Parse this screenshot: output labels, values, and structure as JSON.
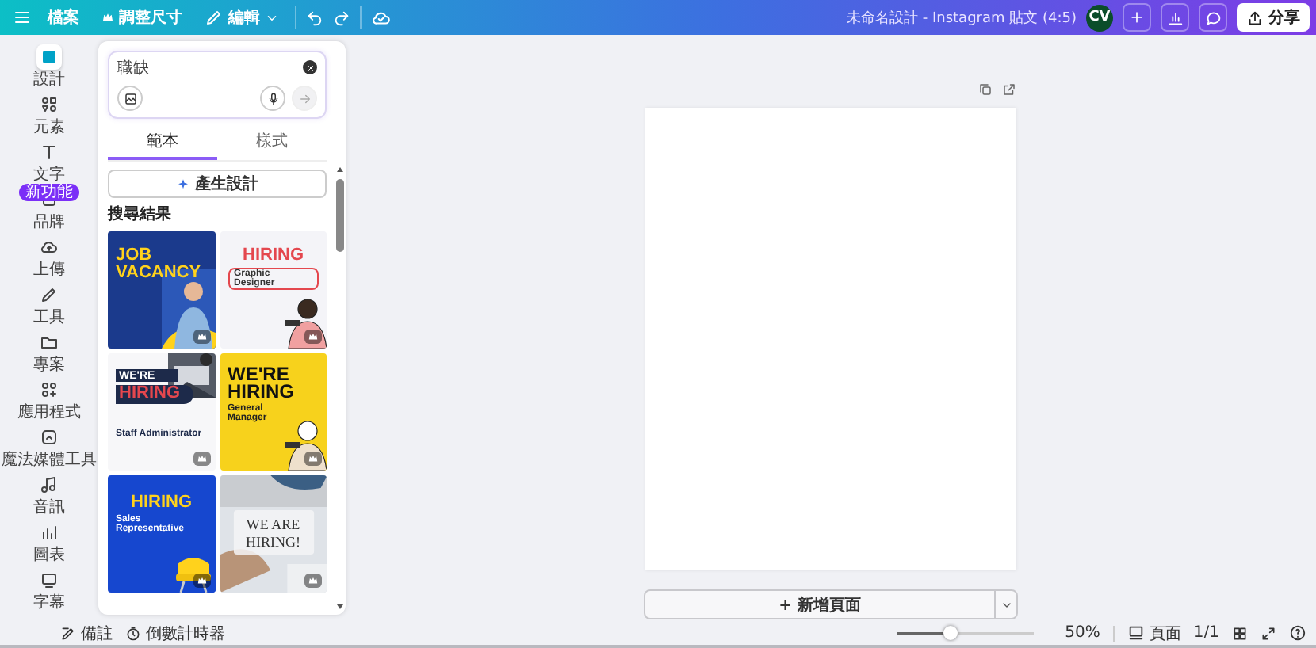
{
  "topbar": {
    "menu_items": [
      {
        "label": "檔案",
        "kind": "plain"
      },
      {
        "label": "調整尺寸",
        "kind": "crown"
      },
      {
        "label": "編輯",
        "kind": "edit"
      }
    ],
    "title": "未命名設計 - Instagram 貼文 (4:5)",
    "avatar": "CV",
    "share": "分享"
  },
  "rail": {
    "items": [
      {
        "label": "設計",
        "selected": true
      },
      {
        "label": "元素",
        "selected": false
      },
      {
        "label": "文字",
        "selected": false
      },
      {
        "label": "品牌",
        "selected": false,
        "badge": "新功能"
      },
      {
        "label": "上傳",
        "selected": false
      },
      {
        "label": "工具",
        "selected": false
      },
      {
        "label": "專案",
        "selected": false
      },
      {
        "label": "應用程式",
        "selected": false
      },
      {
        "label": "魔法媒體工具",
        "selected": false
      },
      {
        "label": "音訊",
        "selected": false
      },
      {
        "label": "圖表",
        "selected": false
      },
      {
        "label": "字幕",
        "selected": false
      }
    ]
  },
  "panel": {
    "search": {
      "value": "職缺"
    },
    "tabs": [
      {
        "label": "範本",
        "selected": true
      },
      {
        "label": "樣式",
        "selected": false
      }
    ],
    "generate_button": "產生設計",
    "results_heading": "搜尋結果",
    "templates": [
      {
        "kind": "navy",
        "headline": "JOB VACANCY"
      },
      {
        "kind": "light",
        "headline": "HIRING",
        "subtitle": "Graphic Designer"
      },
      {
        "kind": "split",
        "kicker": "WE'RE",
        "headline": "HIRING",
        "subtitle": "Staff Administrator"
      },
      {
        "kind": "yellow",
        "headline": "WE'RE HIRING",
        "subtitle": "General Manager"
      },
      {
        "kind": "royal",
        "headline": "HIRING",
        "subtitle": "Sales Representative"
      },
      {
        "headline": "WE ARE HIRING!"
      }
    ]
  },
  "canvas": {
    "add_page": "+ 新增頁面"
  },
  "bottombar": {
    "notes": "備註",
    "timer": "倒數計時器",
    "zoom": {
      "level": 0.4,
      "reading": "50%"
    },
    "pages": "頁面",
    "page_count": "1/1"
  }
}
